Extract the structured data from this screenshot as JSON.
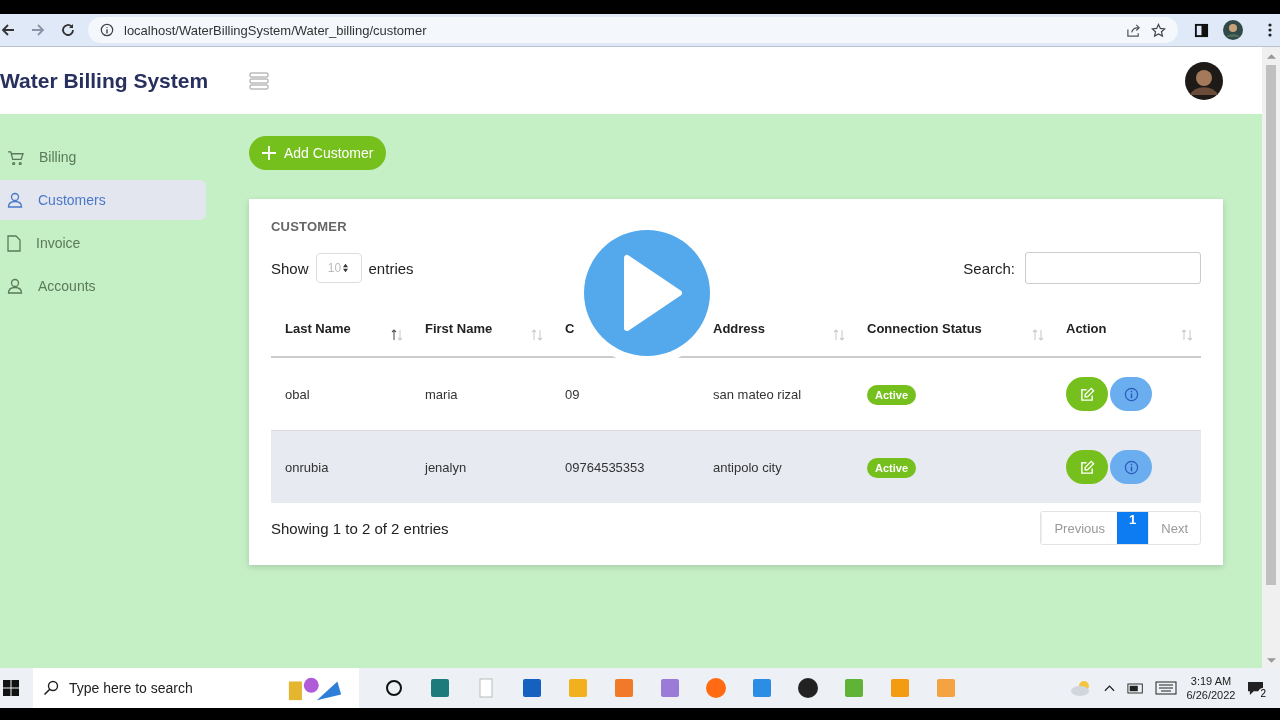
{
  "browser": {
    "url": "localhost/WaterBillingSystem/Water_billing/customer"
  },
  "app": {
    "title": "Water Billing System"
  },
  "sidebar": {
    "items": [
      {
        "label": "Billing",
        "kind": "cart",
        "selected": false
      },
      {
        "label": "Customers",
        "kind": "person",
        "selected": true
      },
      {
        "label": "Invoice",
        "kind": "file",
        "selected": false
      },
      {
        "label": "Accounts",
        "kind": "person",
        "selected": false
      }
    ]
  },
  "add_button": {
    "label": "Add Customer"
  },
  "card": {
    "title": "CUSTOMER",
    "show_label": "Show",
    "page_length": "10",
    "entries_label": "entries",
    "search_label": "Search:",
    "columns": [
      {
        "label": "Last Name",
        "sorted": true
      },
      {
        "label": "First Name",
        "sorted": false
      },
      {
        "label": "C"
      },
      {
        "label": "Address",
        "sorted": false
      },
      {
        "label": "Connection Status",
        "sorted": false
      },
      {
        "label": "Action",
        "sorted": false
      }
    ],
    "rows": [
      {
        "cells": [
          "obal",
          "maria",
          "09",
          "san mateo rizal"
        ],
        "status": "Active",
        "shaded": false
      },
      {
        "cells": [
          "onrubia",
          "jenalyn",
          "09764535353",
          "antipolo city"
        ],
        "status": "Active",
        "shaded": true
      }
    ],
    "info": "Showing 1 to 2 of 2 entries",
    "pagination": [
      {
        "label": "Previous",
        "kind": "nav",
        "selected": false
      },
      {
        "label": "1",
        "kind": "page",
        "selected": true
      },
      {
        "label": "Next",
        "kind": "nav",
        "selected": false
      }
    ]
  },
  "taskbar": {
    "search_placeholder": "Type here to search",
    "time": "3:19 AM",
    "date": "6/26/2022",
    "notifications": "2"
  }
}
